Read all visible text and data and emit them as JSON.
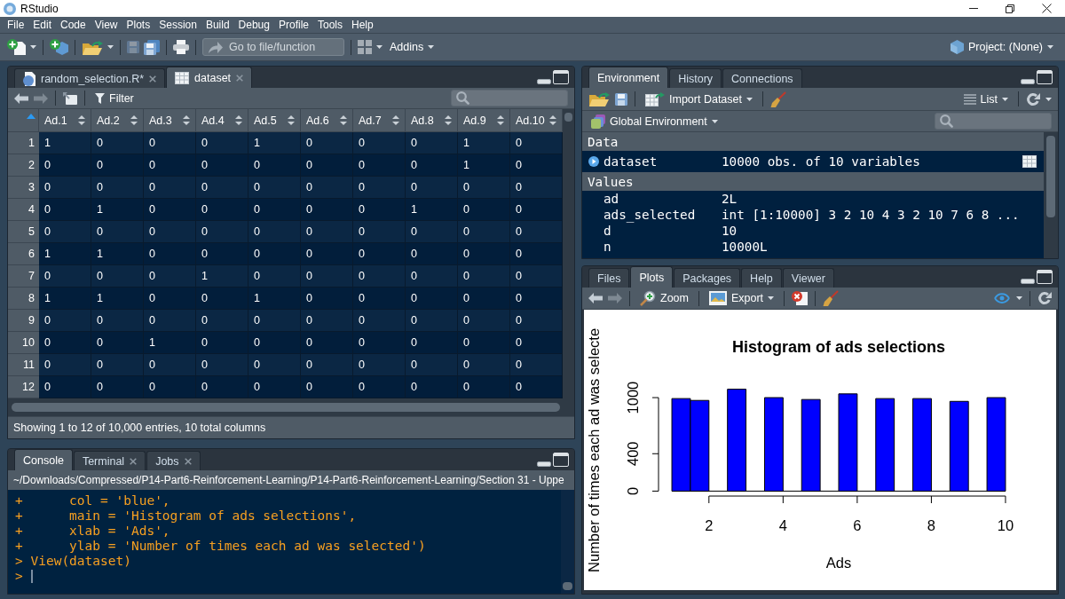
{
  "window": {
    "title": "RStudio"
  },
  "menu": [
    "File",
    "Edit",
    "Code",
    "View",
    "Plots",
    "Session",
    "Build",
    "Debug",
    "Profile",
    "Tools",
    "Help"
  ],
  "main_toolbar": {
    "save": {
      "disabled": true
    },
    "go_to": {
      "placeholder": "Go to file/function"
    },
    "addins": "Addins",
    "project": "Project: (None)"
  },
  "source_pane": {
    "tabs": [
      {
        "label": "random_selection.R*",
        "kind": "script",
        "closable": true,
        "selected": false
      },
      {
        "label": "dataset",
        "kind": "data",
        "closable": true,
        "selected": true
      }
    ],
    "toolbar": {
      "back": {
        "disabled": false
      },
      "forward": {
        "disabled": true
      },
      "filter": "Filter"
    },
    "table": {
      "columns": [
        "Ad.1",
        "Ad.2",
        "Ad.3",
        "Ad.4",
        "Ad.5",
        "Ad.6",
        "Ad.7",
        "Ad.8",
        "Ad.9",
        "Ad.10"
      ],
      "rows": [
        {
          "number": "1",
          "cells": [
            "1",
            "0",
            "0",
            "0",
            "1",
            "0",
            "0",
            "0",
            "1",
            "0"
          ]
        },
        {
          "number": "2",
          "cells": [
            "0",
            "0",
            "0",
            "0",
            "0",
            "0",
            "0",
            "0",
            "1",
            "0"
          ]
        },
        {
          "number": "3",
          "cells": [
            "0",
            "0",
            "0",
            "0",
            "0",
            "0",
            "0",
            "0",
            "0",
            "0"
          ]
        },
        {
          "number": "4",
          "cells": [
            "0",
            "1",
            "0",
            "0",
            "0",
            "0",
            "0",
            "1",
            "0",
            "0"
          ]
        },
        {
          "number": "5",
          "cells": [
            "0",
            "0",
            "0",
            "0",
            "0",
            "0",
            "0",
            "0",
            "0",
            "0"
          ]
        },
        {
          "number": "6",
          "cells": [
            "1",
            "1",
            "0",
            "0",
            "0",
            "0",
            "0",
            "0",
            "0",
            "0"
          ]
        },
        {
          "number": "7",
          "cells": [
            "0",
            "0",
            "0",
            "1",
            "0",
            "0",
            "0",
            "0",
            "0",
            "0"
          ]
        },
        {
          "number": "8",
          "cells": [
            "1",
            "1",
            "0",
            "0",
            "1",
            "0",
            "0",
            "0",
            "0",
            "0"
          ]
        },
        {
          "number": "9",
          "cells": [
            "0",
            "0",
            "0",
            "0",
            "0",
            "0",
            "0",
            "0",
            "0",
            "0"
          ]
        },
        {
          "number": "10",
          "cells": [
            "0",
            "0",
            "1",
            "0",
            "0",
            "0",
            "0",
            "0",
            "0",
            "0"
          ]
        },
        {
          "number": "11",
          "cells": [
            "0",
            "0",
            "0",
            "0",
            "0",
            "0",
            "0",
            "0",
            "0",
            "0"
          ]
        },
        {
          "number": "12",
          "cells": [
            "0",
            "0",
            "0",
            "0",
            "0",
            "0",
            "0",
            "0",
            "0",
            "0"
          ]
        }
      ]
    },
    "footer": "Showing 1 to 12 of 10,000 entries, 10 total columns"
  },
  "console_pane": {
    "tabs": [
      {
        "label": "Console",
        "closable": false,
        "selected": true
      },
      {
        "label": "Terminal",
        "closable": true,
        "selected": false
      },
      {
        "label": "Jobs",
        "closable": true,
        "selected": false
      }
    ],
    "path": "~/Downloads/Compressed/P14-Part6-Reinforcement-Learning/P14-Part6-Reinforcement-Learning/Section 31 - Uppe",
    "lines": [
      {
        "text": "+      col = 'blue',",
        "cursor": false
      },
      {
        "text": "+      main = 'Histogram of ads selections',",
        "cursor": false
      },
      {
        "text": "+      xlab = 'Ads',",
        "cursor": false
      },
      {
        "text": "+      ylab = 'Number of times each ad was selected')",
        "cursor": false
      },
      {
        "text": "> View(dataset)",
        "cursor": false
      },
      {
        "text": ">",
        "cursor": true
      }
    ]
  },
  "environment_pane": {
    "tabs": [
      {
        "label": "Environment",
        "selected": true
      },
      {
        "label": "History",
        "selected": false
      },
      {
        "label": "Connections",
        "selected": false
      }
    ],
    "toolbar": {
      "import": "Import Dataset",
      "view": "List"
    },
    "scope": "Global Environment",
    "sections": [
      {
        "title": "Data",
        "items": [
          {
            "kind": "data",
            "name": "dataset",
            "value": "10000 obs. of 10 variables"
          }
        ]
      },
      {
        "title": "Values",
        "items": [
          {
            "kind": "value",
            "name": "ad",
            "value": "2L"
          },
          {
            "kind": "value",
            "name": "ads_selected",
            "value": "int [1:10000] 3 2 10 4 3 2 10 7 6 8 ..."
          },
          {
            "kind": "value",
            "name": "d",
            "value": "10"
          },
          {
            "kind": "value",
            "name": "n",
            "value": "10000L"
          }
        ]
      }
    ]
  },
  "plots_pane": {
    "tabs": [
      {
        "label": "Files",
        "selected": false
      },
      {
        "label": "Plots",
        "selected": true
      },
      {
        "label": "Packages",
        "selected": false
      },
      {
        "label": "Help",
        "selected": false
      },
      {
        "label": "Viewer",
        "selected": false
      }
    ],
    "toolbar": {
      "back": {
        "disabled": false
      },
      "forward": {
        "disabled": true
      },
      "zoom": "Zoom",
      "export": "Export"
    },
    "chart_data": {
      "type": "bar",
      "title": "Histogram of ads selections",
      "xlabel": "Ads",
      "ylabel": "Number of times each ad was selecte",
      "x": [
        1.25,
        1.75,
        2.75,
        3.75,
        4.75,
        5.75,
        6.75,
        7.75,
        8.75,
        9.75
      ],
      "series": [
        {
          "color": "#0000ff",
          "values": [
            990,
            970,
            1090,
            1000,
            980,
            1040,
            990,
            990,
            960,
            1000
          ]
        }
      ],
      "xlim": [
        1,
        10
      ],
      "ylim": [
        0,
        1090
      ],
      "xticks": [
        2,
        4,
        6,
        8,
        10
      ],
      "yticks": [
        0,
        400,
        1000
      ]
    }
  }
}
